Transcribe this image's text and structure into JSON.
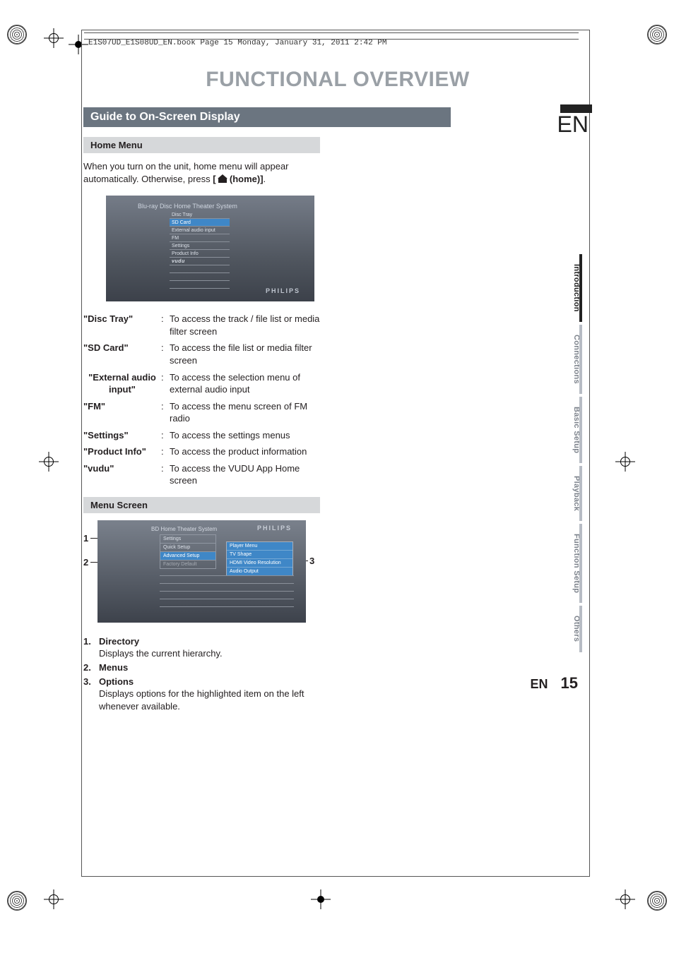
{
  "running_head": "E1S07UD_E1S08UD_EN.book  Page 15  Monday, January 31, 2011  2:42 PM",
  "page_title": "FUNCTIONAL OVERVIEW",
  "section_header": "Guide to On-Screen Display",
  "lang_code_big": "EN",
  "home_menu": {
    "heading": "Home Menu",
    "intro_pre": "When you turn on the unit, home menu will appear automatically. Otherwise, press ",
    "intro_button": "[    (home)]",
    "screenshot": {
      "header": "Blu-ray Disc Home Theater System",
      "items": [
        "Disc Tray",
        "SD Card",
        "External audio input",
        "FM",
        "Settings",
        "Product Info",
        "vudu"
      ],
      "selected_index": 1,
      "brand": "PHILIPS"
    },
    "defs": [
      {
        "term": "\"Disc Tray\"",
        "desc": "To access the track / file list or media filter screen"
      },
      {
        "term": "\"SD Card\"",
        "desc": "To access the file list or media filter screen"
      },
      {
        "term": "\"External audio input\"",
        "desc": "To access the selection menu of external audio input",
        "center": true
      },
      {
        "term": "\"FM\"",
        "desc": "To access the menu screen of FM radio"
      },
      {
        "term": "\"Settings\"",
        "desc": "To access the settings menus"
      },
      {
        "term": "\"Product Info\"",
        "desc": "To access the product information"
      },
      {
        "term": "\"vudu\"",
        "desc": "To access the VUDU App Home screen"
      }
    ]
  },
  "menu_screen": {
    "heading": "Menu Screen",
    "screenshot": {
      "crumb": "BD Home Theater System",
      "brand": "PHILIPS",
      "tab": "Settings",
      "left_items": [
        "Quick Setup",
        "Advanced Setup",
        "Factory Default"
      ],
      "left_selected_index": 1,
      "right_items": [
        "Player Menu",
        "TV Shape",
        "HDMI Video Resolution",
        "Audio Output"
      ]
    },
    "callouts": {
      "one": "1",
      "two": "2",
      "three": "3"
    },
    "list": [
      {
        "n": "1.",
        "head": "Directory",
        "body": "Displays the current hierarchy."
      },
      {
        "n": "2.",
        "head": "Menus",
        "body": ""
      },
      {
        "n": "3.",
        "head": "Options",
        "body": "Displays options for the highlighted item on the left whenever available."
      }
    ]
  },
  "side_tabs": [
    "Introduction",
    "Connections",
    "Basic Setup",
    "Playback",
    "Function Setup",
    "Others"
  ],
  "side_active_index": 0,
  "footer": {
    "lang": "EN",
    "page": "15"
  }
}
